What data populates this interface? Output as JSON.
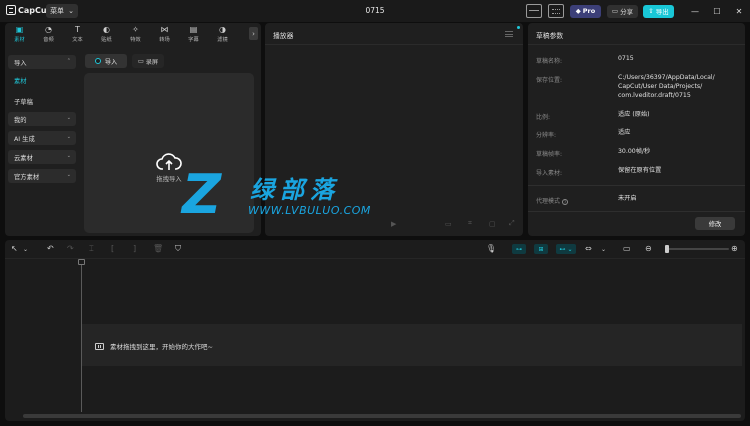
{
  "app": {
    "brand": "CapCut",
    "menu_label": "菜单",
    "project_title": "0715"
  },
  "titlebar": {
    "pro_label": "Pro",
    "share_label": "分享",
    "export_label": "导出"
  },
  "media": {
    "tabs": [
      {
        "label": "素材",
        "icon": "media-icon"
      },
      {
        "label": "音频",
        "icon": "audio-icon"
      },
      {
        "label": "文本",
        "icon": "text-icon"
      },
      {
        "label": "贴纸",
        "icon": "sticker-icon"
      },
      {
        "label": "特效",
        "icon": "effects-icon"
      },
      {
        "label": "转场",
        "icon": "transition-icon"
      },
      {
        "label": "字幕",
        "icon": "caption-icon"
      },
      {
        "label": "滤镜",
        "icon": "filter-icon"
      }
    ],
    "sidebar": {
      "import": "导入",
      "material": "素材",
      "subdraft": "子草稿",
      "mine": "我的",
      "ai": "AI 生成",
      "cloud": "云素材",
      "official": "官方素材"
    },
    "import_button": "导入",
    "record_button": "录屏",
    "drop_label": "拖拽导入"
  },
  "player": {
    "title": "播放器"
  },
  "draft": {
    "title": "草稿参数",
    "rows": {
      "name_label": "草稿名称:",
      "name_value": "0715",
      "path_label": "保存位置:",
      "path_line1": "C:/Users/36397/AppData/Local/",
      "path_line2": "CapCut/User Data/Projects/",
      "path_line3": "com.lveditor.draft/0715",
      "ratio_label": "比例:",
      "ratio_value": "适应 (原始)",
      "res_label": "分辨率:",
      "res_value": "适应",
      "fps_label": "草稿帧率:",
      "fps_value": "30.00帧/秒",
      "import_label": "导入素材:",
      "import_value": "保留在原有位置",
      "proxy_label": "代理模式",
      "proxy_value": "未开启"
    },
    "modify_button": "修改"
  },
  "timeline": {
    "hint": "素材拖拽到这里，开始你的大作吧~"
  },
  "watermark": {
    "mark": "Z",
    "cn": "绿部落",
    "url": "WWW.LVBULUO.COM"
  },
  "colors": {
    "accent": "#1fc8da",
    "pro": "#3c3f78",
    "export": "#19c7d7",
    "watermark": "#1aa5e0"
  }
}
